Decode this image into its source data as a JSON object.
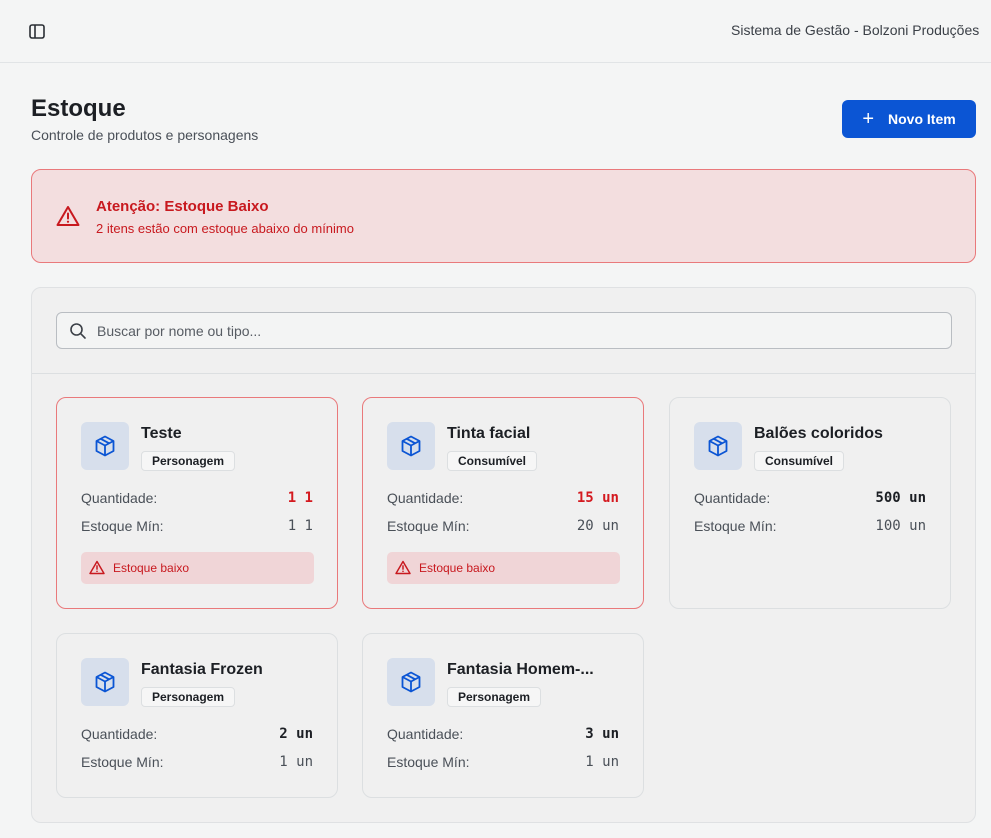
{
  "header": {
    "app_title": "Sistema de Gestão - Bolzoni Produções"
  },
  "page": {
    "title": "Estoque",
    "subtitle": "Controle de produtos e personagens",
    "new_button_label": "Novo Item"
  },
  "alert": {
    "title": "Atenção: Estoque Baixo",
    "text": "2 itens estão com estoque abaixo do mínimo"
  },
  "search": {
    "placeholder": "Buscar por nome ou tipo...",
    "value": ""
  },
  "labels": {
    "quantity": "Quantidade:",
    "min_stock": "Estoque Mín:",
    "low_stock": "Estoque baixo"
  },
  "items": [
    {
      "name": "Teste",
      "type": "Personagem",
      "quantity": "1 1",
      "min": "1 1",
      "low": true
    },
    {
      "name": "Tinta facial",
      "type": "Consumível",
      "quantity": "15 un",
      "min": "20 un",
      "low": true
    },
    {
      "name": "Balões coloridos",
      "type": "Consumível",
      "quantity": "500 un",
      "min": "100 un",
      "low": false
    },
    {
      "name": "Fantasia Frozen",
      "type": "Personagem",
      "quantity": "2 un",
      "min": "1 un",
      "low": false
    },
    {
      "name": "Fantasia Homem-...",
      "type": "Personagem",
      "quantity": "3 un",
      "min": "1 un",
      "low": false
    }
  ],
  "colors": {
    "accent": "#0b55d4",
    "danger": "#c8191f",
    "alert_bg": "#f3dedf",
    "icon_bg": "#d7dfec"
  }
}
